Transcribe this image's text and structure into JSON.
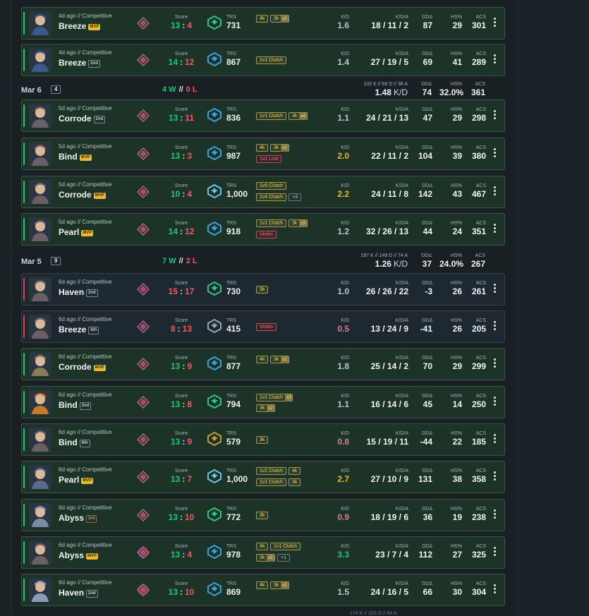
{
  "labels": {
    "score": "Score",
    "trs": "TRS",
    "kd": "K/D",
    "kda": "K/D/A",
    "dd": "DDΔ",
    "hs": "HS%",
    "acs": "ACS",
    "score_sep": ":",
    "wl_sep": "//"
  },
  "days": {
    "mar6": {
      "date": "Mar 6",
      "count": "4",
      "wins": "4 W",
      "losses": "0 L",
      "agg_line": "102 K // 69 D // 36 A",
      "kd": "1.48",
      "kd_unit": "K/D",
      "dd": "74",
      "hs": "32.0%",
      "acs": "361"
    },
    "mar5": {
      "date": "Mar 5",
      "count": "9",
      "wins": "7 W",
      "losses": "2 L",
      "agg_line": "187 K // 149 D // 74 A",
      "kd": "1.26",
      "kd_unit": "K/D",
      "dd": "37",
      "hs": "24.0%",
      "acs": "267"
    }
  },
  "bottom_cut": "174 K // 153 D // 64 A",
  "matches": [
    {
      "meta": "4d ago // Competitive",
      "map": "Breeze",
      "badge": "MVP",
      "badge_type": "mvp",
      "score_a": "13",
      "score_b": "4",
      "trs": "731",
      "tags": [
        [
          "4k",
          ""
        ],
        [
          "3k",
          "x2"
        ]
      ],
      "kd": "1.6",
      "kd_class": "n",
      "kda": "18 / 11 / 2",
      "dd": "87",
      "hs": "29",
      "acs": "301"
    },
    {
      "meta": "4d ago // Competitive",
      "map": "Breeze",
      "badge": "2nd",
      "badge_type": "pl",
      "score_a": "14",
      "score_b": "12",
      "trs": "867",
      "tags": [
        [
          "1v1 Clutch",
          ""
        ]
      ],
      "kd": "1.4",
      "kd_class": "n",
      "kda": "27 / 19 / 5",
      "dd": "69",
      "hs": "41",
      "acs": "289"
    },
    {
      "meta": "5d ago // Competitive",
      "map": "Corrode",
      "badge": "2nd",
      "badge_type": "pl",
      "score_a": "13",
      "score_b": "11",
      "trs": "836",
      "tags": [
        [
          "1v1 Clutch",
          ""
        ],
        [
          "3k",
          "x4"
        ]
      ],
      "kd": "1.1",
      "kd_class": "n",
      "kda": "24 / 21 / 13",
      "dd": "47",
      "hs": "29",
      "acs": "298"
    },
    {
      "meta": "5d ago // Competitive",
      "map": "Bind",
      "badge": "MVP",
      "badge_type": "mvp",
      "score_a": "13",
      "score_b": "3",
      "trs": "987",
      "tags": [
        [
          "4k",
          ""
        ],
        [
          "3k",
          "x2"
        ],
        [
          "1v1 Lost",
          ""
        ]
      ],
      "kd": "2.0",
      "kd_class": "y",
      "kda": "22 / 11 / 2",
      "dd": "104",
      "hs": "39",
      "acs": "380"
    },
    {
      "meta": "5d ago // Competitive",
      "map": "Corrode",
      "badge": "MVP",
      "badge_type": "mvp",
      "score_a": "10",
      "score_b": "4",
      "trs": "1,000",
      "tags": [
        [
          "1v5 Clutch",
          ""
        ],
        [
          "1v4 Clutch",
          ""
        ],
        [
          "+3",
          ""
        ]
      ],
      "kd": "2.2",
      "kd_class": "y",
      "kda": "24 / 11 / 8",
      "dd": "142",
      "hs": "43",
      "acs": "467"
    },
    {
      "meta": "5d ago // Competitive",
      "map": "Pearl",
      "badge": "MVP",
      "badge_type": "mvp",
      "score_a": "14",
      "score_b": "12",
      "trs": "918",
      "tags": [
        [
          "1v1 Clutch",
          ""
        ],
        [
          "3k",
          "x3"
        ],
        [
          "Victim",
          ""
        ]
      ],
      "kd": "1.2",
      "kd_class": "n",
      "kda": "32 / 26 / 13",
      "dd": "44",
      "hs": "24",
      "acs": "351"
    },
    {
      "meta": "6d ago // Competitive",
      "map": "Haven",
      "badge": "2nd",
      "badge_type": "pl",
      "score_a": "15",
      "score_b": "17",
      "trs": "730",
      "tags": [
        [
          "3k",
          ""
        ]
      ],
      "kd": "1.0",
      "kd_class": "n",
      "kda": "26 / 26 / 22",
      "dd": "-3",
      "hs": "26",
      "acs": "261"
    },
    {
      "meta": "6d ago // Competitive",
      "map": "Breeze",
      "badge": "6th",
      "badge_type": "pl",
      "score_a": "8",
      "score_b": "13",
      "trs": "415",
      "tags": [
        [
          "Victim",
          ""
        ]
      ],
      "kd": "0.5",
      "kd_class": "p",
      "kda": "13 / 24 / 9",
      "dd": "-41",
      "hs": "26",
      "acs": "205"
    },
    {
      "meta": "6d ago // Competitive",
      "map": "Corrode",
      "badge": "MVP",
      "badge_type": "mvp",
      "score_a": "13",
      "score_b": "9",
      "trs": "877",
      "tags": [
        [
          "4k",
          ""
        ],
        [
          "3k",
          "x2"
        ]
      ],
      "kd": "1.8",
      "kd_class": "n",
      "kda": "25 / 14 / 2",
      "dd": "70",
      "hs": "29",
      "acs": "299"
    },
    {
      "meta": "6d ago // Competitive",
      "map": "Bind",
      "badge": "2nd",
      "badge_type": "pl",
      "score_a": "13",
      "score_b": "8",
      "trs": "794",
      "tags": [
        [
          "1v1 Clutch",
          "x3"
        ],
        [
          "3k",
          "x2"
        ]
      ],
      "kd": "1.1",
      "kd_class": "n",
      "kda": "16 / 14 / 6",
      "dd": "45",
      "hs": "14",
      "acs": "250"
    },
    {
      "meta": "6d ago // Competitive",
      "map": "Bind",
      "badge": "9th",
      "badge_type": "pl",
      "score_a": "13",
      "score_b": "9",
      "trs": "579",
      "tags": [
        [
          "3k",
          ""
        ]
      ],
      "kd": "0.8",
      "kd_class": "p",
      "kda": "15 / 19 / 11",
      "dd": "-44",
      "hs": "22",
      "acs": "185"
    },
    {
      "meta": "6d ago // Competitive",
      "map": "Pearl",
      "badge": "MVP",
      "badge_type": "mvp",
      "score_a": "13",
      "score_b": "7",
      "trs": "1,000",
      "tags": [
        [
          "1v2 Clutch",
          ""
        ],
        [
          "4k",
          ""
        ],
        [
          "1v1 Clutch",
          ""
        ],
        [
          "3k",
          ""
        ]
      ],
      "kd": "2.7",
      "kd_class": "y",
      "kda": "27 / 10 / 9",
      "dd": "131",
      "hs": "38",
      "acs": "358"
    },
    {
      "meta": "6d ago // Competitive",
      "map": "Abyss",
      "badge": "3rd",
      "badge_type": "pl3",
      "score_a": "13",
      "score_b": "10",
      "trs": "772",
      "tags": [
        [
          "3k",
          ""
        ]
      ],
      "kd": "0.9",
      "kd_class": "p",
      "kda": "18 / 19 / 6",
      "dd": "36",
      "hs": "19",
      "acs": "238"
    },
    {
      "meta": "6d ago // Competitive",
      "map": "Abyss",
      "badge": "MVP",
      "badge_type": "mvp",
      "score_a": "13",
      "score_b": "4",
      "trs": "978",
      "tags": [
        [
          "4k",
          ""
        ],
        [
          "1v1 Clutch",
          ""
        ],
        [
          "3k",
          "x2"
        ],
        [
          "+1",
          ""
        ]
      ],
      "kd": "3.3",
      "kd_class": "gg",
      "kda": "23 / 7 / 4",
      "dd": "112",
      "hs": "27",
      "acs": "325"
    },
    {
      "meta": "6d ago // Competitive",
      "map": "Haven",
      "badge": "2nd",
      "badge_type": "pl",
      "score_a": "13",
      "score_b": "10",
      "trs": "869",
      "tags": [
        [
          "4k",
          ""
        ],
        [
          "3k",
          "x2"
        ]
      ],
      "kd": "1.5",
      "kd_class": "n",
      "kda": "24 / 16 / 5",
      "dd": "66",
      "hs": "30",
      "acs": "304"
    }
  ]
}
